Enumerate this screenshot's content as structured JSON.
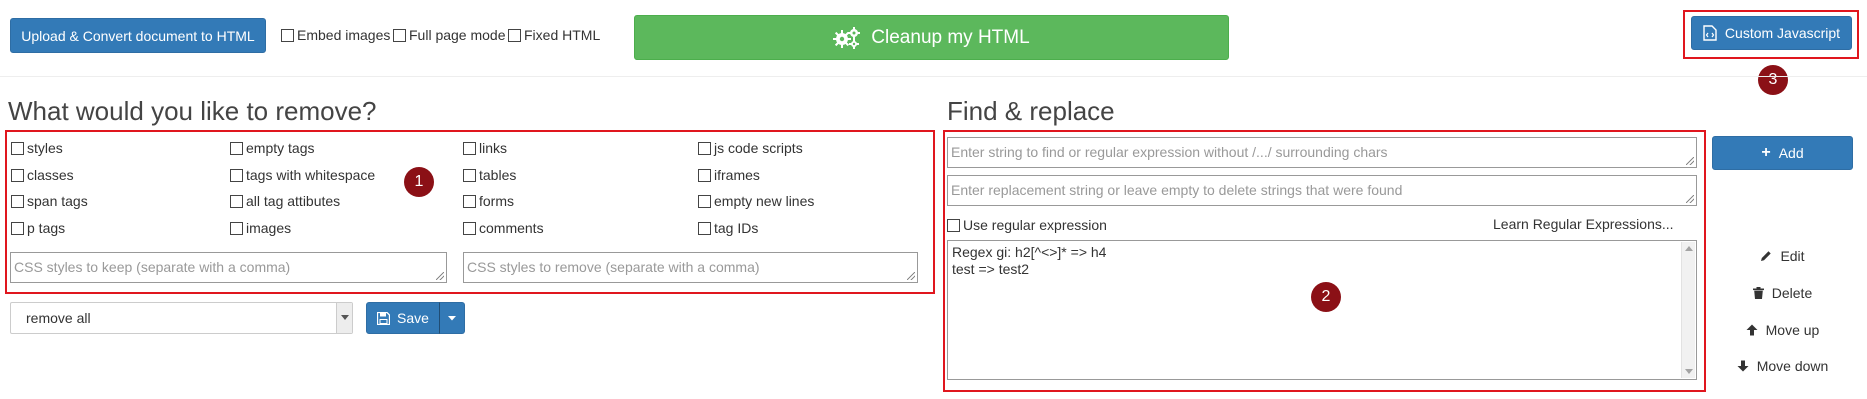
{
  "toolbar": {
    "upload_label": "Upload & Convert document to HTML",
    "embed_images_label": "Embed images",
    "full_page_mode_label": "Full page mode",
    "fixed_html_label": "Fixed HTML",
    "cleanup_label": "Cleanup my HTML",
    "custom_js_label": "Custom Javascript"
  },
  "remove_section": {
    "title": "What would you like to remove?",
    "options": [
      "styles",
      "empty tags",
      "links",
      "js code scripts",
      "classes",
      "tags with whitespace",
      "tables",
      "iframes",
      "span tags",
      "all tag attibutes",
      "forms",
      "empty new lines",
      "p tags",
      "images",
      "comments",
      "tag IDs"
    ],
    "css_keep_placeholder": "CSS styles to keep (separate with a comma)",
    "css_remove_placeholder": "CSS styles to remove (separate with a comma)",
    "preset_value": "remove all",
    "save_label": "Save"
  },
  "find_replace": {
    "title": "Find & replace",
    "find_placeholder": "Enter string to find or regular expression without /.../ surrounding chars",
    "replace_placeholder": "Enter replacement string or leave empty to delete strings that were found",
    "use_regex_label": "Use regular expression",
    "learn_regex_label": "Learn Regular Expressions...",
    "rules": [
      "Regex gi: h2[^<>]* => h4",
      "test => test2"
    ],
    "add_label": "Add",
    "edit_label": "Edit",
    "delete_label": "Delete",
    "move_up_label": "Move up",
    "move_down_label": "Move down"
  },
  "markers": [
    "1",
    "2",
    "3"
  ],
  "colors": {
    "primary": "#337ab7",
    "success": "#5cb85c",
    "highlight_border": "#e0161e",
    "marker": "#8b1016"
  }
}
